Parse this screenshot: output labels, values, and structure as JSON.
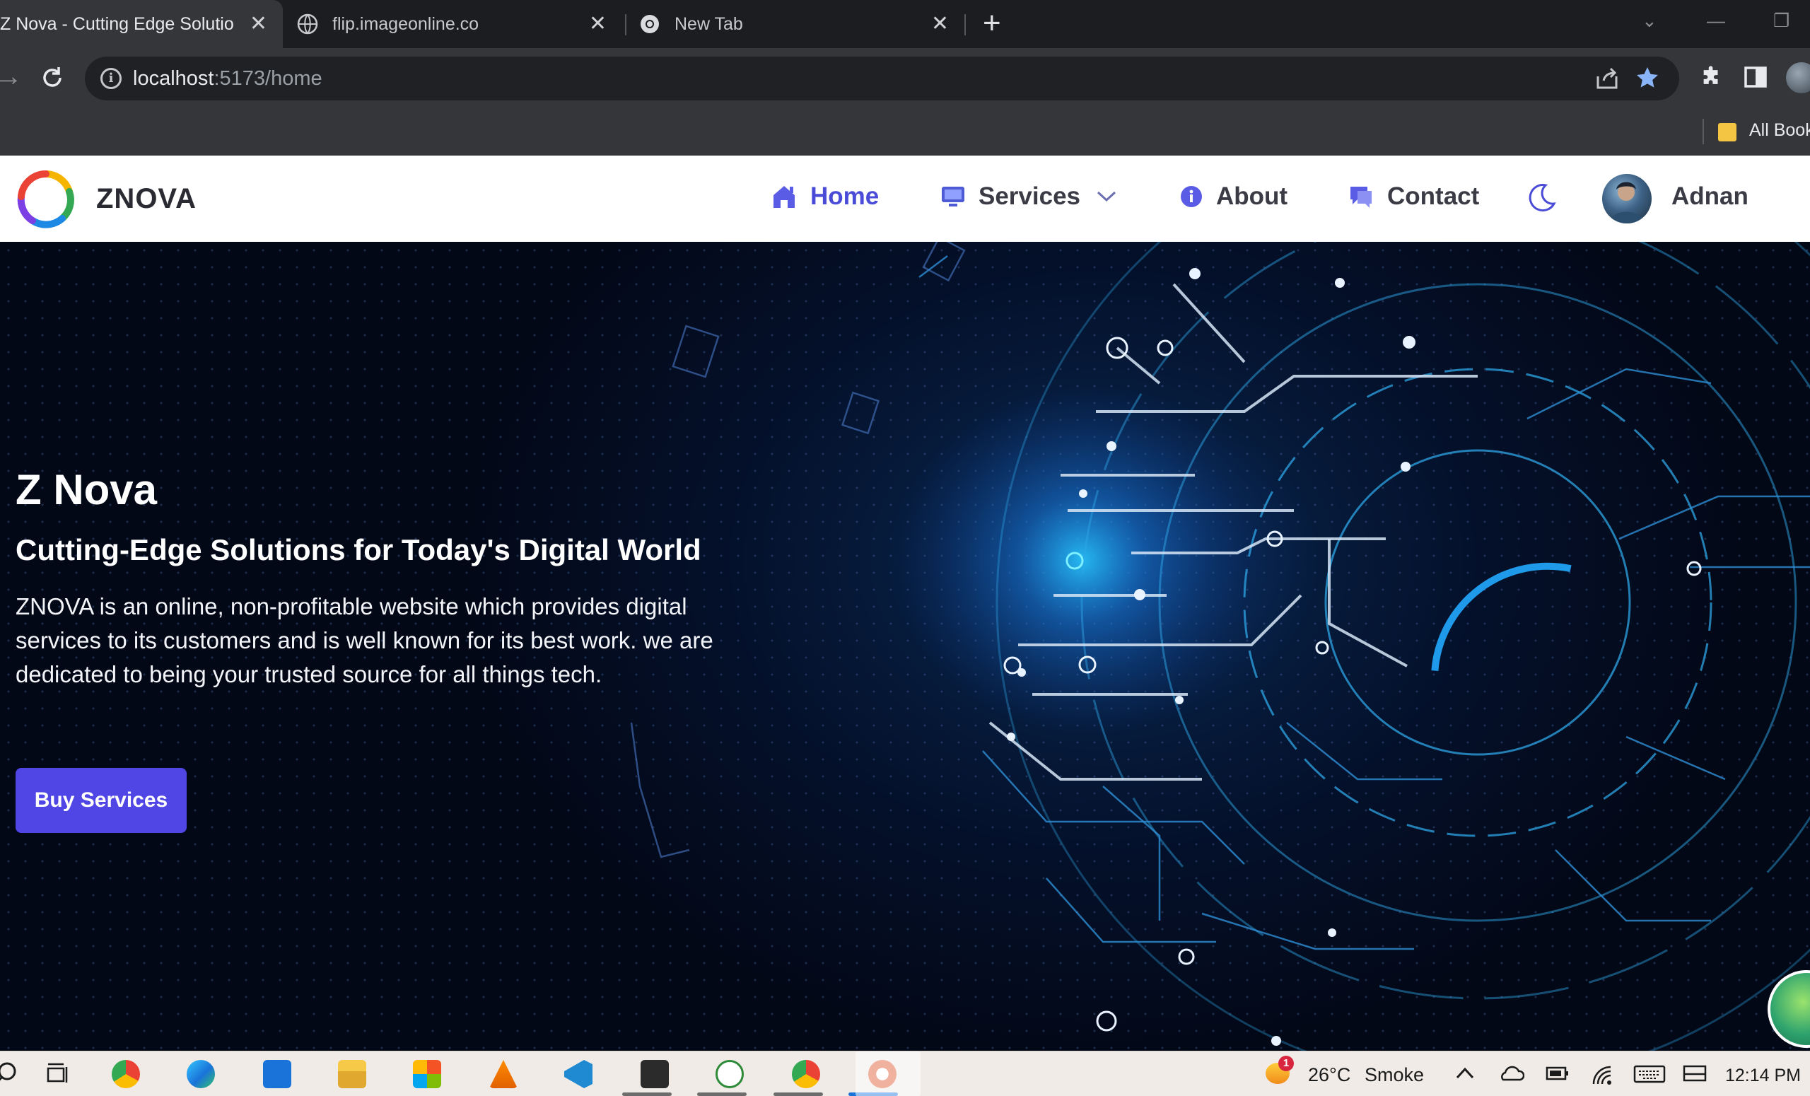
{
  "browser": {
    "tabs": [
      {
        "title": "Z Nova - Cutting Edge Solutions",
        "close": "✕"
      },
      {
        "title": "flip.imageonline.co",
        "close": "✕"
      },
      {
        "title": "New Tab",
        "close": "✕"
      }
    ],
    "new_tab": "+",
    "url_host": "localhost",
    "url_path": ":5173/home",
    "bookmarks_label": "All Bookmarks"
  },
  "site": {
    "brand": "ZNOVA",
    "nav": {
      "home": "Home",
      "services": "Services",
      "about": "About",
      "contact": "Contact"
    },
    "user_name": "Adnan",
    "accent_color": "#4f46e5"
  },
  "hero": {
    "title": "Z Nova",
    "subtitle": "Cutting-Edge Solutions for Today's Digital World",
    "description": "ZNOVA is an online, non-profitable website which provides digital services to its customers and is well known for its best work. we are dedicated to being your trusted source for all things tech.",
    "cta": "Buy Services"
  },
  "taskbar": {
    "temperature": "26°C",
    "weather": "Smoke",
    "weather_badge": "1",
    "time": "12:14 PM"
  }
}
